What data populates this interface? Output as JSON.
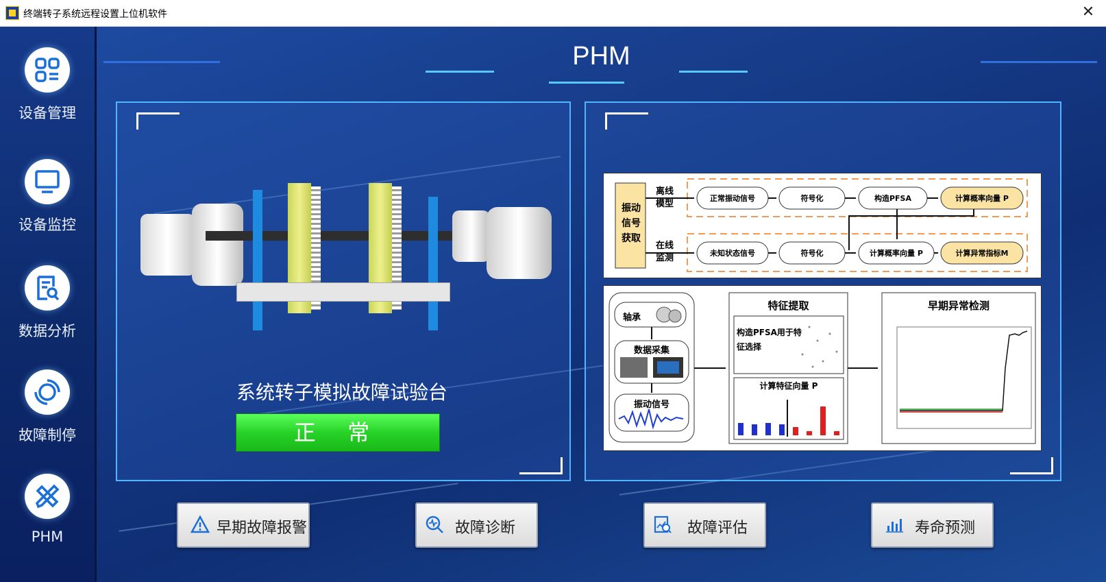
{
  "window": {
    "title": "终端转子系统远程设置上位机软件"
  },
  "sidebar": {
    "items": [
      {
        "label": "设备管理",
        "icon": "grid-icon"
      },
      {
        "label": "设备监控",
        "icon": "monitor-icon"
      },
      {
        "label": "数据分析",
        "icon": "report-search-icon"
      },
      {
        "label": "故障制停",
        "icon": "stop-ring-icon"
      },
      {
        "label": "PHM",
        "icon": "tools-icon"
      }
    ]
  },
  "header": {
    "title": "PHM"
  },
  "left_panel": {
    "rig_title": "系统转子模拟故障试验台",
    "status": "正 常",
    "status_color": "#27d227"
  },
  "right_panel": {
    "top_diagram": {
      "source_label": "振动信号获取",
      "offline_label": "离线模型",
      "online_label": "在线监测",
      "offline_steps": [
        "正常振动信号",
        "符号化",
        "构造PFSA",
        "计算概率向量 P"
      ],
      "online_steps": [
        "未知状态信号",
        "符号化",
        "计算概率向量 P",
        "计算异常指标M"
      ]
    },
    "bottom_diagram": {
      "bearing_label": "轴承",
      "acquisition_label": "数据采集",
      "vibration_label": "振动信号",
      "feature_title": "特征提取",
      "feature_note": "构造PFSA用于特征选择",
      "feature_vector_title": "计算特征向量 P",
      "detection_title": "早期异常检测"
    }
  },
  "buttons": [
    {
      "label": "早期故障报警",
      "icon": "warning-icon"
    },
    {
      "label": "故障诊断",
      "icon": "diagnosis-icon"
    },
    {
      "label": "故障评估",
      "icon": "assessment-icon"
    },
    {
      "label": "寿命预测",
      "icon": "bar-chart-icon"
    }
  ],
  "colors": {
    "accent": "#4fb6ff",
    "background": "#163a86",
    "sidebar": "#0d2a6b"
  }
}
